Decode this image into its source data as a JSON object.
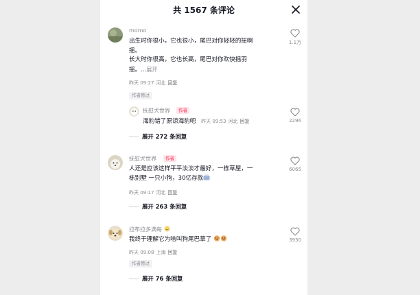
{
  "header": {
    "title": "共 1567 条评论"
  },
  "comments": [
    {
      "user": "momo",
      "lines": [
        "出生时你很小，它也很小，尾巴对你轻轻的摇啊",
        "摇。",
        "长大时你很高，它也长高，尾巴对你欢快摇羽",
        "摇。..."
      ],
      "expand_inline": "展开",
      "time": "昨天 09:27",
      "location": "河北",
      "reply": "回复",
      "author_liked": "作者赞过",
      "likes": "1.1万"
    },
    {
      "user": "抚慰犬世界",
      "author_tag": "作者",
      "text": "海豹错了原谅海豹吧",
      "time": "昨天 09:53",
      "location": "河北",
      "reply": "回复",
      "likes": "2296"
    },
    {
      "user": "抚慰犬世界",
      "author_tag": "作者",
      "lines": [
        "人还是应该这样平平淡淡才最好，一栋草屋，一",
        "栋别墅 一只小狗，30亿存款"
      ],
      "time": "昨天 09:17",
      "location": "河北",
      "reply": "回复",
      "likes": "6065",
      "expand_replies": "展开 263 条回复"
    },
    {
      "user": "拉布拉多满每",
      "text": "我终于理解它为啥叫狗尾巴草了",
      "time": "昨天 09:08",
      "location": "上海",
      "reply": "回复",
      "author_liked": "作者赞过",
      "likes": "3930",
      "expand_replies": "展开 76 条回复"
    }
  ],
  "expand_replies_1": "展开 272 条回复"
}
